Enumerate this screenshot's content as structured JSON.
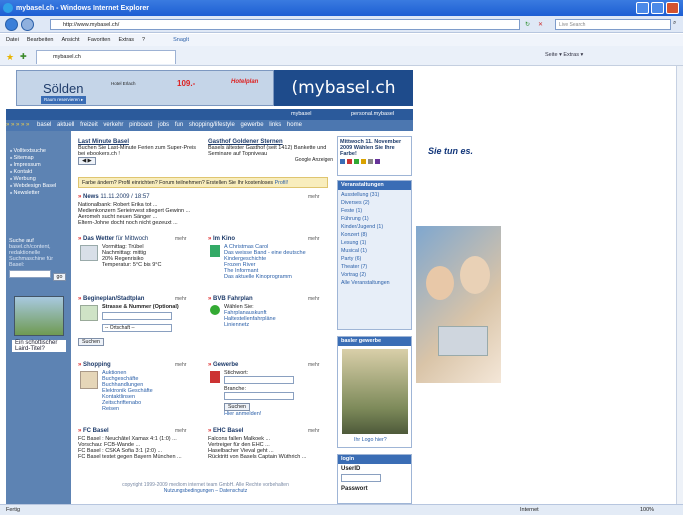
{
  "window": {
    "title": "mybasel.ch - Windows Internet Explorer"
  },
  "address": {
    "url": "http://www.mybasel.ch/",
    "search_placeholder": "Live Search"
  },
  "menu": [
    "Datei",
    "Bearbeiten",
    "Ansicht",
    "Favoriten",
    "Extras",
    "?"
  ],
  "menu_extra": "SnagIt",
  "favbar": {
    "tab_label": "mybasel.ch",
    "tools": "Seite ▾   Extras ▾"
  },
  "banner": {
    "headline": "Sölden",
    "hotel": "Hotel Erlach",
    "price": "109.-",
    "brand": "Hotelplan",
    "cta": "Raum reservieren ▸"
  },
  "logo": "(mybasel.ch",
  "tabs": {
    "left": "mybasel",
    "right": "personal.mybasel"
  },
  "topnav": {
    "arrows": "» » » » »",
    "items": [
      "basel",
      "aktuell",
      "freizeit",
      "verkehr",
      "pinboard",
      "jobs",
      "fun",
      "shopping/lifestyle",
      "gewerbe",
      "links",
      "home"
    ]
  },
  "side": {
    "items": [
      "Volltextsuche",
      "Sitemap",
      "Impressum",
      "Kontakt",
      "Werbung",
      "Webdesign Basel",
      "Newsletter"
    ],
    "search_title": "Suche auf",
    "search_desc": "basel.ch/content, redaktionelle Suchmaschine für Basel:",
    "go": "go",
    "caption": "Ein schottischer Laird-Titel?"
  },
  "lastminute": {
    "title": "Last Minute Basel",
    "text": "Buchen Sie Last-Minute Ferien zum Super-Preis bei ebookers.ch !"
  },
  "gasthof": {
    "title": "Gasthof Goldener Sternen",
    "text": "Basels ältester Gasthof (seit 1412) Bankette und Seminare auf Topniveau",
    "ads": "Google Anzeigen"
  },
  "date_box": {
    "text": "Mittwoch 11. November 2009 Wählen Sie Ihre Farbe!"
  },
  "hint": {
    "text": "Farbe ändern? Profil einrichten? Forum teilnehmen? Erstellen Sie Ihr kostenloses",
    "link": "Profil!"
  },
  "news": {
    "title": "News",
    "time": "11.11.2009 / 18:57",
    "more": "mehr",
    "items": [
      "Nationalbank: Robert Erika tot ...",
      "Medienkonzern Serieinvest stiegert Gewinn ...",
      "Aeromeh sucht neuen Sänger ...",
      "Eltern-Johne docht noch nicht gezeuxt ..."
    ]
  },
  "wetter": {
    "title": "Das Wetter",
    "sub": "für Mittwoch",
    "more": "mehr",
    "lines": [
      "Vormittag: Trübel",
      "Nachmittag: mittig",
      "20% Regenrisiko",
      "Temperatur: 5°C bis 9°C"
    ]
  },
  "kino": {
    "title": "Im Kino",
    "more": "mehr",
    "items": [
      "A Christmas Carol",
      "Das weisse Band - eine deutsche Kindergeschichte",
      "Frozen River",
      "The Informant"
    ],
    "link": "Das aktuelle Kinoprogramm"
  },
  "veranst": {
    "title": "Veranstaltungen",
    "items": [
      "Ausstellung (31)",
      "Diverses (2)",
      "Feste (1)",
      "Führung (1)",
      "Kinder/Jugend (1)",
      "Konzert (8)",
      "Lesung (1)",
      "Musical (1)",
      "Party (6)",
      "Theater (7)",
      "Vortrag (2)"
    ],
    "all": "Alle Veranstaltungen"
  },
  "stadtplan": {
    "title": "Begineplan/Stadtplan",
    "label": "Strasse & Nummer (Optional)",
    "select": "-- Ortschaft --",
    "button": "Suchen",
    "more": "mehr"
  },
  "bvb": {
    "title": "BVB Fahrplan",
    "more": "mehr",
    "lines": [
      "Wählen Sie:",
      "Fahrplanauskunft",
      "Haltestellenfahrpläne",
      "Liniennetz"
    ]
  },
  "shopping": {
    "title": "Shopping",
    "more": "mehr",
    "items": [
      "Auktionen",
      "Buchgeschäfte",
      "Buchhandlungen",
      "Elektronik Geschäfte",
      "Kontaktlinsen",
      "Zeitschriftenabo",
      "Reisen"
    ]
  },
  "gewerbe": {
    "title": "Gewerbe",
    "more": "mehr",
    "label1": "Stichwort:",
    "label2": "Branche:",
    "button": "Suchen",
    "link": "Hier anmelden!"
  },
  "basler_gewerbe": {
    "title": "basler gewerbe",
    "link": "Ihr Logo hier?"
  },
  "fcbasel": {
    "title": "FC Basel",
    "more": "mehr",
    "items": [
      "FC Basel : Neuchâtel Xamax 4:1 (1:0) ...",
      "Vorschau: FCB-Wande ...",
      "FC Basel : CSKA Sofia 3:1 (2:0) ...",
      "FC Basel testet gegen Bayern München ..."
    ]
  },
  "ehc": {
    "title": "EHC Basel",
    "more": "mehr",
    "items": [
      "Falcons fallen Malkoek ...",
      "Vertreiger für den EHC ...",
      "Haselbacher Vieval geht ...",
      "Rücktritt von Basels Captain Wüthrich ..."
    ]
  },
  "login": {
    "title": "login",
    "user": "UserID",
    "pass": "Passwort"
  },
  "footer": {
    "line1": "copyright 1999-2009 mediom internet team GmbH. Alle Rechte vorbehalten",
    "line2": "Nutzungsbedingungen – Datenschutz"
  },
  "ad": {
    "slogan": "Sie tun es."
  },
  "status": {
    "left": "Fertig",
    "zone": "Internet",
    "zoom": "100%"
  }
}
